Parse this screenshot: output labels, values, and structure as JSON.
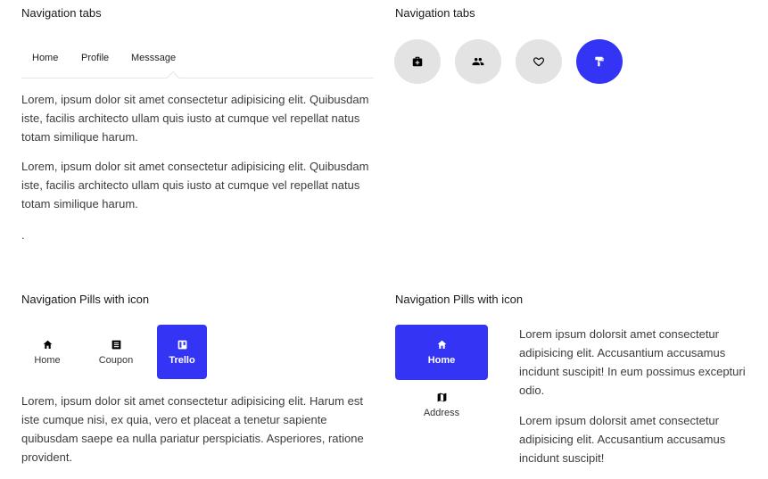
{
  "colors": {
    "accent": "#3434f5",
    "circle_bg": "#e3e3e3",
    "text": "#3c3c3c"
  },
  "top_left": {
    "title": "Navigation tabs",
    "tabs": [
      {
        "label": "Home",
        "active": false
      },
      {
        "label": "Profile",
        "active": false
      },
      {
        "label": "Messsage",
        "active": true
      }
    ],
    "paragraphs": [
      "Lorem, ipsum dolor sit amet consectetur adipisicing elit. Quibusdam iste, facilis architecto ullam quis iusto at cumque vel repellat natus totam similique harum.",
      "Lorem, ipsum dolor sit amet consectetur adipisicing elit. Quibusdam iste, facilis architecto ullam quis iusto at cumque vel repellat natus totam similique harum.",
      "."
    ]
  },
  "top_right": {
    "title": "Navigation tabs",
    "circle_tabs": [
      {
        "icon": "medical-bag-icon",
        "active": false
      },
      {
        "icon": "people-icon",
        "active": false
      },
      {
        "icon": "heart-icon",
        "active": false
      },
      {
        "icon": "paint-roller-icon",
        "active": true
      }
    ]
  },
  "bottom_left": {
    "title": "Navigation Pills with icon",
    "pills": [
      {
        "label": "Home",
        "icon": "home-icon",
        "active": false
      },
      {
        "label": "Coupon",
        "icon": "list-icon",
        "active": false
      },
      {
        "label": "Trello",
        "icon": "trello-icon",
        "active": true
      }
    ],
    "paragraph": "Lorem, ipsum dolor sit amet consectetur adipisicing elit. Harum est iste cumque nisi, ex quia, vero et placeat a tenetur sapiente quibusdam saepe ea nulla pariatur perspiciatis. Asperiores, ratione provident."
  },
  "bottom_right": {
    "title": "Navigation Pills with icon",
    "pills": [
      {
        "label": "Home",
        "icon": "home-icon",
        "active": true
      },
      {
        "label": "Address",
        "icon": "map-icon",
        "active": false
      }
    ],
    "paragraphs": [
      "Lorem ipsum dolorsit amet consectetur adipisicing elit. Accusantium accusamus incidunt suscipit! In eum possimus excepturi odio.",
      "Lorem ipsum dolorsit amet consectetur adipisicing elit. Accusantium accusamus incidunt suscipit!"
    ]
  }
}
